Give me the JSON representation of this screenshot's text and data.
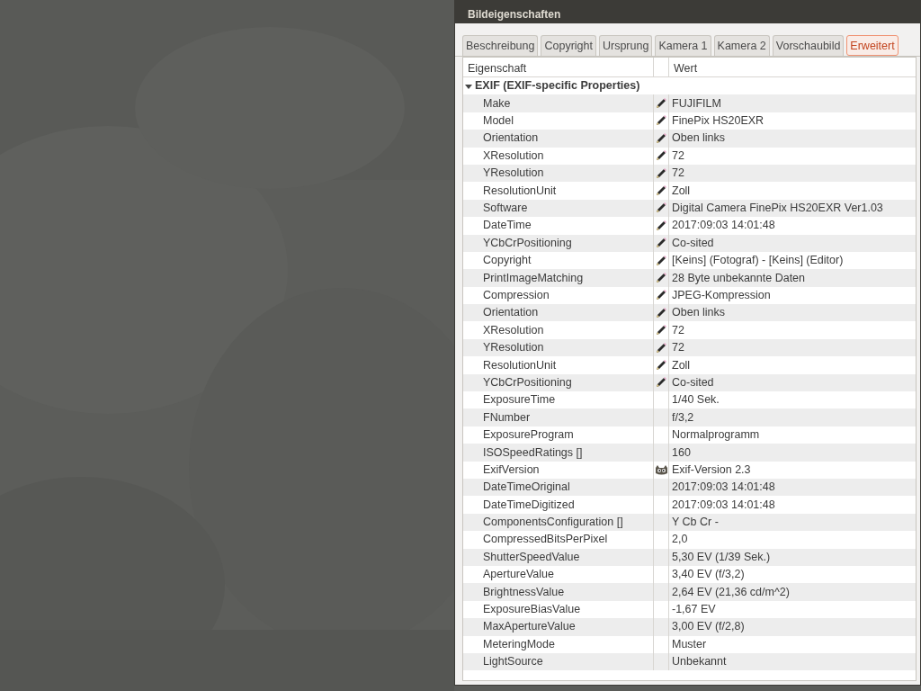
{
  "window": {
    "title": "Bildeigenschaften"
  },
  "tabs": [
    {
      "label": "Beschreibung",
      "selected": false
    },
    {
      "label": "Copyright",
      "selected": false
    },
    {
      "label": "Ursprung",
      "selected": false
    },
    {
      "label": "Kamera 1",
      "selected": false
    },
    {
      "label": "Kamera 2",
      "selected": false
    },
    {
      "label": "Vorschaubild",
      "selected": false
    },
    {
      "label": "Erweitert",
      "selected": true
    }
  ],
  "table": {
    "columns": [
      "Eigenschaft",
      "Wert"
    ],
    "groups": [
      {
        "label": "EXIF (EXIF-specific Properties)",
        "expanded": true,
        "children": [
          {
            "name": "Make",
            "kind": "editable",
            "value": "FUJIFILM"
          },
          {
            "name": "Model",
            "kind": "editable",
            "value": "FinePix HS20EXR"
          },
          {
            "name": "Orientation",
            "kind": "editable",
            "value": "Oben links"
          },
          {
            "name": "XResolution",
            "kind": "editable",
            "value": "72"
          },
          {
            "name": "YResolution",
            "kind": "editable",
            "value": "72"
          },
          {
            "name": "ResolutionUnit",
            "kind": "editable",
            "value": "Zoll"
          },
          {
            "name": "Software",
            "kind": "editable",
            "value": "Digital Camera FinePix HS20EXR Ver1.03"
          },
          {
            "name": "DateTime",
            "kind": "editable",
            "value": "2017:09:03 14:01:48"
          },
          {
            "name": "YCbCrPositioning",
            "kind": "editable",
            "value": "Co-sited"
          },
          {
            "name": "Copyright",
            "kind": "editable",
            "value": "[Keins] (Fotograf) - [Keins] (Editor)"
          },
          {
            "name": "PrintImageMatching",
            "kind": "editable",
            "value": "28 Byte unbekannte Daten"
          },
          {
            "name": "Compression",
            "kind": "editable",
            "value": "JPEG-Kompression"
          },
          {
            "name": "Orientation",
            "kind": "editable",
            "value": "Oben links"
          },
          {
            "name": "XResolution",
            "kind": "editable",
            "value": "72"
          },
          {
            "name": "YResolution",
            "kind": "editable",
            "value": "72"
          },
          {
            "name": "ResolutionUnit",
            "kind": "editable",
            "value": "Zoll"
          },
          {
            "name": "YCbCrPositioning",
            "kind": "editable",
            "value": "Co-sited"
          },
          {
            "name": "ExposureTime",
            "kind": "plain",
            "value": "1/40 Sek."
          },
          {
            "name": "FNumber",
            "kind": "plain",
            "value": "f/3,2"
          },
          {
            "name": "ExposureProgram",
            "kind": "plain",
            "value": "Normalprogramm"
          },
          {
            "name": "ISOSpeedRatings []",
            "kind": "plain",
            "value": "160"
          },
          {
            "name": "ExifVersion",
            "kind": "exif",
            "value": "Exif-Version 2.3"
          },
          {
            "name": "DateTimeOriginal",
            "kind": "plain",
            "value": "2017:09:03 14:01:48"
          },
          {
            "name": "DateTimeDigitized",
            "kind": "plain",
            "value": "2017:09:03 14:01:48"
          },
          {
            "name": "ComponentsConfiguration []",
            "kind": "plain",
            "value": "Y Cb Cr -"
          },
          {
            "name": "CompressedBitsPerPixel",
            "kind": "plain",
            "value": "2,0"
          },
          {
            "name": "ShutterSpeedValue",
            "kind": "plain",
            "value": "5,30 EV (1/39 Sek.)"
          },
          {
            "name": "ApertureValue",
            "kind": "plain",
            "value": "3,40 EV (f/3,2)"
          },
          {
            "name": "BrightnessValue",
            "kind": "plain",
            "value": "2,64 EV (21,36 cd/m^2)"
          },
          {
            "name": "ExposureBiasValue",
            "kind": "plain",
            "value": "-1,67 EV"
          },
          {
            "name": "MaxApertureValue",
            "kind": "plain",
            "value": "3,00 EV (f/2,8)"
          },
          {
            "name": "MeteringMode",
            "kind": "plain",
            "value": "Muster"
          },
          {
            "name": "LightSource",
            "kind": "plain",
            "value": "Unbekannt"
          }
        ]
      }
    ]
  }
}
